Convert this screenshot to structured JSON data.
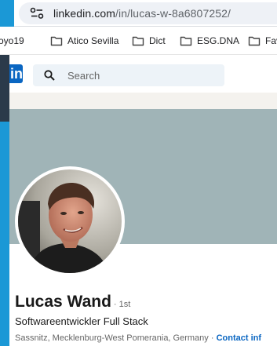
{
  "browser": {
    "url_host": "linkedin.com",
    "url_path": "/in/lucas-w-8a6807252/"
  },
  "bookmarks": [
    {
      "label": "oyo19",
      "icon": "none"
    },
    {
      "label": "Atico Sevilla",
      "icon": "folder-icon"
    },
    {
      "label": "Dict",
      "icon": "folder-icon"
    },
    {
      "label": "ESG.DNA",
      "icon": "folder-icon"
    },
    {
      "label": "Fav",
      "icon": "folder-icon"
    }
  ],
  "linkedin": {
    "logo_text": "in",
    "search_placeholder": "Search"
  },
  "profile": {
    "name": "Lucas Wand",
    "degree": "· 1st",
    "headline": "Softwareentwickler Full Stack",
    "location": "Sassnitz, Mecklenburg-West Pomerania, Germany ·",
    "contact_link": "Contact inf"
  },
  "colors": {
    "linkedin_blue": "#0a66c2",
    "cover": "#a0b4b7",
    "desktop_blue": "#1b98d6"
  }
}
